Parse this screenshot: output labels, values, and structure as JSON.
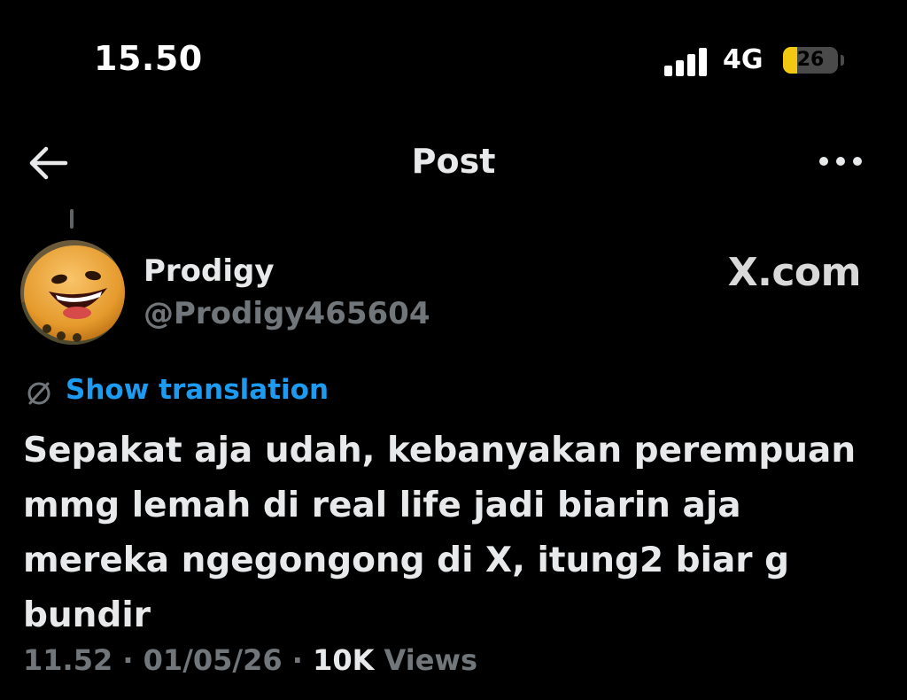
{
  "status_bar": {
    "time": "15.50",
    "network": "4G",
    "battery_level": "26"
  },
  "header": {
    "title": "Post",
    "back_icon": "arrow-left-icon",
    "more_icon": "more-horizontal-icon"
  },
  "post": {
    "author": {
      "display_name": "Prodigy",
      "handle": "@Prodigy465604"
    },
    "site": "X.com",
    "translate": {
      "icon": "globe-icon",
      "label": "Show translation"
    },
    "body": "Sepakat aja udah, kebanyakan perempuan mmg lemah di real life jadi biarin aja mereka ngegongong di X, itung2 biar g bundir",
    "meta": {
      "time": "11.52",
      "separator": " · ",
      "date": "01/05/26",
      "views_count": "10K",
      "views_label": "Views"
    }
  },
  "colors": {
    "background": "#000000",
    "text_primary": "#e7e9ea",
    "text_secondary": "#71767b",
    "link": "#1d9bf0",
    "battery": "#f2c811"
  }
}
